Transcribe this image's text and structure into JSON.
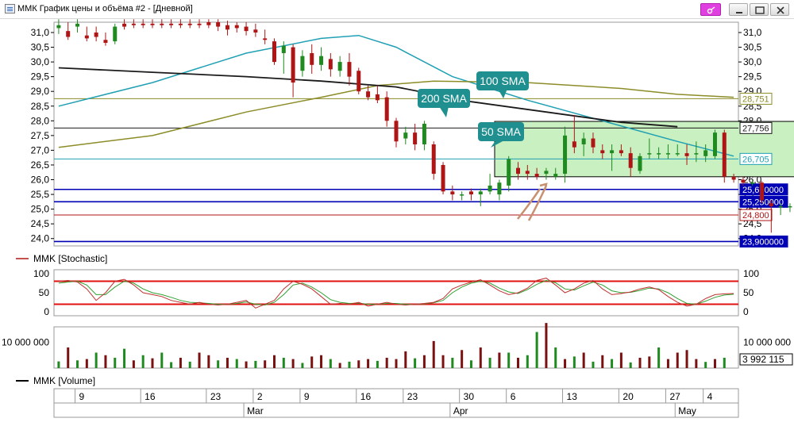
{
  "window": {
    "title": "ММК График цены и объёма #2 - [Дневной]"
  },
  "colors": {
    "bull": "#1f8a1f",
    "bear": "#b01515",
    "sma50": "#20a0b4",
    "sma100": "#8c8c28",
    "sma200": "#1a1a1a",
    "stoch_k": "#c03030",
    "stoch_d": "#30a030",
    "level_blue": "#0000b4",
    "zone_fill": "#c8f0c0",
    "callout": "#1f8f8f",
    "arrow": "#c89070"
  },
  "legend": {
    "stochastic": "MMK [Stochastic]",
    "volume": "MMK [Volume]"
  },
  "chart_data": {
    "type": "candlestick",
    "price_axis": {
      "ylim": [
        23.75,
        31.35
      ],
      "ticks": [
        "31,0",
        "30,5",
        "30,0",
        "29,5",
        "29,0",
        "28,5",
        "28,0",
        "27,5",
        "27,0",
        "26,5",
        "26,0",
        "25,5",
        "25,0",
        "24,5",
        "24,0"
      ],
      "tick_values": [
        31.0,
        30.5,
        30.0,
        29.5,
        29.0,
        28.5,
        28.0,
        27.5,
        27.0,
        26.5,
        26.0,
        25.5,
        25.0,
        24.5,
        24.0
      ]
    },
    "date_axis": {
      "day_labels": [
        "9",
        "16",
        "23",
        "2",
        "9",
        "16",
        "23",
        "30",
        "6",
        "13",
        "20",
        "27",
        "4"
      ],
      "day_label_index": [
        2,
        9,
        16,
        21,
        26,
        32,
        37,
        43,
        48,
        54,
        60,
        65,
        69
      ],
      "month_labels": [
        "Mar",
        "Apr",
        "May"
      ],
      "month_label_index": [
        20,
        42,
        66
      ]
    },
    "candles": [
      {
        "o": 31.15,
        "c": 31.25,
        "h": 31.45,
        "l": 30.95
      },
      {
        "o": 31.05,
        "c": 30.85,
        "h": 31.35,
        "l": 30.75
      },
      {
        "o": 31.2,
        "c": 31.3,
        "h": 31.45,
        "l": 31.0
      },
      {
        "o": 30.9,
        "c": 30.8,
        "h": 31.2,
        "l": 30.7
      },
      {
        "o": 31.0,
        "c": 30.85,
        "h": 31.2,
        "l": 30.7
      },
      {
        "o": 30.75,
        "c": 30.65,
        "h": 31.0,
        "l": 30.55
      },
      {
        "o": 30.7,
        "c": 31.2,
        "h": 31.3,
        "l": 30.6
      },
      {
        "o": 31.3,
        "c": 31.2,
        "h": 31.45,
        "l": 31.1
      },
      {
        "o": 31.3,
        "c": 31.25,
        "h": 31.45,
        "l": 31.15
      },
      {
        "o": 31.3,
        "c": 31.25,
        "h": 31.45,
        "l": 31.15
      },
      {
        "o": 31.3,
        "c": 31.25,
        "h": 31.45,
        "l": 31.15
      },
      {
        "o": 31.3,
        "c": 31.25,
        "h": 31.45,
        "l": 31.15
      },
      {
        "o": 31.3,
        "c": 31.25,
        "h": 31.45,
        "l": 31.15
      },
      {
        "o": 31.3,
        "c": 31.25,
        "h": 31.45,
        "l": 31.15
      },
      {
        "o": 31.3,
        "c": 31.25,
        "h": 31.45,
        "l": 31.15
      },
      {
        "o": 31.3,
        "c": 31.25,
        "h": 31.45,
        "l": 31.15
      },
      {
        "o": 31.35,
        "c": 31.25,
        "h": 31.45,
        "l": 31.15
      },
      {
        "o": 31.35,
        "c": 31.2,
        "h": 31.45,
        "l": 31.05
      },
      {
        "o": 31.25,
        "c": 31.1,
        "h": 31.4,
        "l": 30.9
      },
      {
        "o": 31.25,
        "c": 31.15,
        "h": 31.35,
        "l": 31.0
      },
      {
        "o": 31.2,
        "c": 31.05,
        "h": 31.35,
        "l": 30.9
      },
      {
        "o": 31.1,
        "c": 31.0,
        "h": 31.3,
        "l": 30.85
      },
      {
        "o": 30.8,
        "c": 30.75,
        "h": 31.1,
        "l": 30.6
      },
      {
        "o": 30.7,
        "c": 30.0,
        "h": 30.8,
        "l": 29.9
      },
      {
        "o": 30.3,
        "c": 30.55,
        "h": 30.7,
        "l": 29.6
      },
      {
        "o": 30.5,
        "c": 29.3,
        "h": 30.6,
        "l": 28.8
      },
      {
        "o": 29.7,
        "c": 30.2,
        "h": 30.4,
        "l": 29.5
      },
      {
        "o": 30.3,
        "c": 29.9,
        "h": 30.6,
        "l": 29.6
      },
      {
        "o": 29.9,
        "c": 30.2,
        "h": 30.5,
        "l": 29.7
      },
      {
        "o": 30.1,
        "c": 29.75,
        "h": 30.3,
        "l": 29.5
      },
      {
        "o": 29.7,
        "c": 30.0,
        "h": 30.2,
        "l": 29.5
      },
      {
        "o": 30.0,
        "c": 29.5,
        "h": 30.3,
        "l": 29.2
      },
      {
        "o": 29.7,
        "c": 29.0,
        "h": 29.8,
        "l": 28.9
      },
      {
        "o": 29.0,
        "c": 28.8,
        "h": 29.2,
        "l": 28.7
      },
      {
        "o": 28.9,
        "c": 28.7,
        "h": 29.2,
        "l": 28.6
      },
      {
        "o": 28.8,
        "c": 28.0,
        "h": 29.0,
        "l": 27.8
      },
      {
        "o": 28.0,
        "c": 27.3,
        "h": 28.1,
        "l": 27.1
      },
      {
        "o": 27.4,
        "c": 27.6,
        "h": 27.8,
        "l": 27.2
      },
      {
        "o": 27.6,
        "c": 27.2,
        "h": 27.9,
        "l": 27.0
      },
      {
        "o": 27.2,
        "c": 27.9,
        "h": 28.0,
        "l": 27.0
      },
      {
        "o": 27.2,
        "c": 26.2,
        "h": 27.3,
        "l": 26.0
      },
      {
        "o": 26.5,
        "c": 25.6,
        "h": 26.6,
        "l": 25.5
      },
      {
        "o": 25.6,
        "c": 25.5,
        "h": 25.8,
        "l": 25.3
      },
      {
        "o": 25.5,
        "c": 25.5,
        "h": 25.6,
        "l": 25.3
      },
      {
        "o": 25.6,
        "c": 25.5,
        "h": 25.7,
        "l": 25.3
      },
      {
        "o": 25.5,
        "c": 25.6,
        "h": 25.7,
        "l": 25.1
      },
      {
        "o": 25.6,
        "c": 25.8,
        "h": 26.2,
        "l": 25.5
      },
      {
        "o": 25.5,
        "c": 25.9,
        "h": 26.0,
        "l": 25.3
      },
      {
        "o": 25.8,
        "c": 26.7,
        "h": 26.8,
        "l": 25.6
      },
      {
        "o": 26.4,
        "c": 26.2,
        "h": 26.6,
        "l": 26.0
      },
      {
        "o": 26.3,
        "c": 26.2,
        "h": 26.5,
        "l": 26.0
      },
      {
        "o": 26.2,
        "c": 26.1,
        "h": 26.4,
        "l": 26.0
      },
      {
        "o": 26.2,
        "c": 26.3,
        "h": 26.4,
        "l": 26.0
      },
      {
        "o": 26.1,
        "c": 26.2,
        "h": 26.4,
        "l": 26.0
      },
      {
        "o": 26.2,
        "c": 27.5,
        "h": 27.8,
        "l": 25.9
      },
      {
        "o": 27.3,
        "c": 27.1,
        "h": 28.2,
        "l": 26.9
      },
      {
        "o": 27.2,
        "c": 27.4,
        "h": 27.6,
        "l": 26.8
      },
      {
        "o": 27.4,
        "c": 27.1,
        "h": 27.6,
        "l": 26.9
      },
      {
        "o": 27.0,
        "c": 26.9,
        "h": 27.2,
        "l": 26.7
      },
      {
        "o": 26.9,
        "c": 27.0,
        "h": 27.2,
        "l": 26.3
      },
      {
        "o": 27.0,
        "c": 26.9,
        "h": 27.2,
        "l": 26.8
      },
      {
        "o": 26.9,
        "c": 26.4,
        "h": 27.1,
        "l": 26.1
      },
      {
        "o": 26.3,
        "c": 26.8,
        "h": 26.9,
        "l": 26.2
      },
      {
        "o": 26.9,
        "c": 26.9,
        "h": 27.4,
        "l": 26.7
      },
      {
        "o": 26.9,
        "c": 26.9,
        "h": 27.1,
        "l": 26.7
      },
      {
        "o": 26.9,
        "c": 26.9,
        "h": 27.2,
        "l": 26.7
      },
      {
        "o": 26.9,
        "c": 26.9,
        "h": 27.2,
        "l": 26.8
      },
      {
        "o": 26.9,
        "c": 26.8,
        "h": 27.2,
        "l": 26.5
      },
      {
        "o": 26.9,
        "c": 26.9,
        "h": 27.3,
        "l": 26.6
      },
      {
        "o": 26.8,
        "c": 27.0,
        "h": 27.2,
        "l": 26.6
      },
      {
        "o": 26.8,
        "c": 27.6,
        "h": 27.7,
        "l": 26.7
      },
      {
        "o": 27.6,
        "c": 26.1,
        "h": 27.7,
        "l": 25.9
      },
      {
        "o": 26.1,
        "c": 26.0,
        "h": 26.2,
        "l": 25.9
      },
      {
        "o": 26.0,
        "c": 25.9,
        "h": 26.1,
        "l": 25.8
      },
      {
        "o": 25.9,
        "c": 25.9,
        "h": 26.0,
        "l": 25.8
      },
      {
        "o": 25.9,
        "c": 25.3,
        "h": 25.95,
        "l": 25.2
      },
      {
        "o": 25.2,
        "c": 25.1,
        "h": 25.3,
        "l": 24.2
      },
      {
        "o": 25.1,
        "c": 25.1,
        "h": 25.2,
        "l": 24.8
      },
      {
        "o": 25.1,
        "c": 25.1,
        "h": 25.2,
        "l": 24.9
      },
      {
        "o": 25.1,
        "c": 25.0,
        "h": 25.2,
        "l": 24.9
      },
      {
        "o": 25.0,
        "c": 25.0,
        "h": 25.1,
        "l": 24.9
      },
      {
        "o": 25.0,
        "c": 24.95,
        "h": 25.1,
        "l": 24.9
      },
      {
        "o": 24.9,
        "c": 24.4,
        "h": 25.3,
        "l": 24.3
      },
      {
        "o": 24.5,
        "c": 24.8,
        "h": 24.9,
        "l": 23.9
      }
    ],
    "sma_series": [
      {
        "name": "50 SMA",
        "points": [
          [
            0,
            28.5
          ],
          [
            10,
            29.3
          ],
          [
            20,
            30.3
          ],
          [
            28,
            30.8
          ],
          [
            32,
            30.9
          ],
          [
            36,
            30.5
          ],
          [
            42,
            29.5
          ],
          [
            50,
            28.7
          ],
          [
            58,
            28.0
          ],
          [
            66,
            27.3
          ],
          [
            72,
            26.8
          ]
        ]
      },
      {
        "name": "100 SMA",
        "points": [
          [
            0,
            27.1
          ],
          [
            10,
            27.5
          ],
          [
            20,
            28.3
          ],
          [
            28,
            28.8
          ],
          [
            34,
            29.2
          ],
          [
            40,
            29.35
          ],
          [
            50,
            29.3
          ],
          [
            60,
            29.1
          ],
          [
            66,
            28.9
          ],
          [
            72,
            28.8
          ]
        ]
      },
      {
        "name": "200 SMA",
        "points": [
          [
            0,
            29.8
          ],
          [
            10,
            29.65
          ],
          [
            20,
            29.5
          ],
          [
            28,
            29.35
          ],
          [
            36,
            29.15
          ],
          [
            44,
            28.65
          ],
          [
            52,
            28.3
          ],
          [
            60,
            27.95
          ],
          [
            66,
            27.8
          ]
        ]
      }
    ],
    "levels": [
      {
        "value": 28.751,
        "label": "28,751",
        "color": "#8c8c28"
      },
      {
        "value": 27.756,
        "label": "27,756",
        "color": "#1a1a1a"
      },
      {
        "value": 26.705,
        "label": "26,705",
        "color": "#20a0b4"
      },
      {
        "value": 25.67,
        "label": "25,670000",
        "color": "#0000b4"
      },
      {
        "value": 25.25,
        "label": "25,250000",
        "color": "#0000b4"
      },
      {
        "value": 24.8,
        "label": "24,800",
        "color": "#b01515"
      },
      {
        "value": 23.9,
        "label": "23,900000",
        "color": "#0000b4"
      }
    ],
    "annotations": {
      "callouts": [
        "200 SMA",
        "100 SMA",
        "50 SMA"
      ],
      "zone": {
        "x0": 47,
        "x1": 81,
        "y0": 26.1,
        "y1": 27.98
      }
    },
    "stochastic": {
      "ylim": [
        -10,
        110
      ],
      "ticks": [
        "100",
        "50",
        "0"
      ],
      "tick_values": [
        100,
        50,
        0
      ],
      "levels": [
        80,
        20
      ],
      "k": [
        80,
        82,
        78,
        60,
        30,
        50,
        80,
        85,
        70,
        50,
        45,
        40,
        30,
        25,
        20,
        25,
        20,
        18,
        20,
        25,
        30,
        10,
        20,
        30,
        60,
        80,
        72,
        60,
        40,
        20,
        22,
        20,
        25,
        15,
        20,
        25,
        20,
        18,
        20,
        22,
        25,
        35,
        60,
        70,
        78,
        84,
        70,
        55,
        45,
        50,
        62,
        82,
        88,
        70,
        50,
        60,
        75,
        82,
        60,
        45,
        48,
        52,
        60,
        65,
        58,
        40,
        25,
        15,
        20,
        35,
        45,
        47,
        48
      ],
      "d": [
        75,
        78,
        80,
        70,
        45,
        45,
        65,
        80,
        75,
        60,
        50,
        45,
        38,
        30,
        25,
        24,
        22,
        20,
        20,
        22,
        26,
        20,
        18,
        25,
        45,
        70,
        75,
        65,
        50,
        32,
        25,
        22,
        23,
        20,
        20,
        22,
        22,
        20,
        20,
        21,
        24,
        30,
        50,
        65,
        75,
        80,
        75,
        62,
        52,
        48,
        58,
        72,
        82,
        76,
        60,
        57,
        68,
        78,
        70,
        55,
        50,
        51,
        56,
        62,
        60,
        50,
        35,
        22,
        20,
        28,
        38,
        44,
        46
      ]
    },
    "volume": {
      "tick_label": "10 000 000",
      "tick_value": 10000000,
      "ylim": [
        0,
        16000000
      ],
      "last_value_label": "3 992 115",
      "values": [
        2.6,
        8,
        3,
        3.5,
        6,
        5,
        4,
        7.5,
        3,
        5,
        3.8,
        6,
        2.3,
        4,
        2.5,
        6,
        5,
        3,
        4,
        3.5,
        2.6,
        2.8,
        3,
        5,
        4,
        3.5,
        2,
        4.5,
        5,
        3.5,
        2,
        2.5,
        3,
        3.5,
        2.8,
        4,
        3.5,
        6.5,
        3.8,
        5,
        10.5,
        5,
        4,
        7,
        3,
        8,
        4,
        6,
        6,
        4,
        5,
        14,
        17.5,
        8,
        3.5,
        4.5,
        6,
        2.5,
        5,
        3.5,
        6,
        2.2,
        4,
        4.5,
        8,
        3.5,
        6,
        7,
        3.5,
        2.4,
        3.5,
        4
      ],
      "colors": [
        "g",
        "r",
        "g",
        "r",
        "g",
        "r",
        "g",
        "g",
        "r",
        "g",
        "r",
        "g",
        "g",
        "r",
        "g",
        "r",
        "r",
        "g",
        "r",
        "g",
        "r",
        "g",
        "r",
        "r",
        "g",
        "r",
        "g",
        "r",
        "r",
        "g",
        "r",
        "g",
        "r",
        "r",
        "g",
        "r",
        "r",
        "r",
        "g",
        "r",
        "r",
        "r",
        "g",
        "r",
        "g",
        "r",
        "g",
        "r",
        "g",
        "r",
        "g",
        "g",
        "r",
        "g",
        "r",
        "g",
        "r",
        "g",
        "r",
        "g",
        "r",
        "g",
        "r",
        "r",
        "g",
        "r",
        "r",
        "r",
        "r",
        "g",
        "r",
        "g"
      ]
    }
  }
}
